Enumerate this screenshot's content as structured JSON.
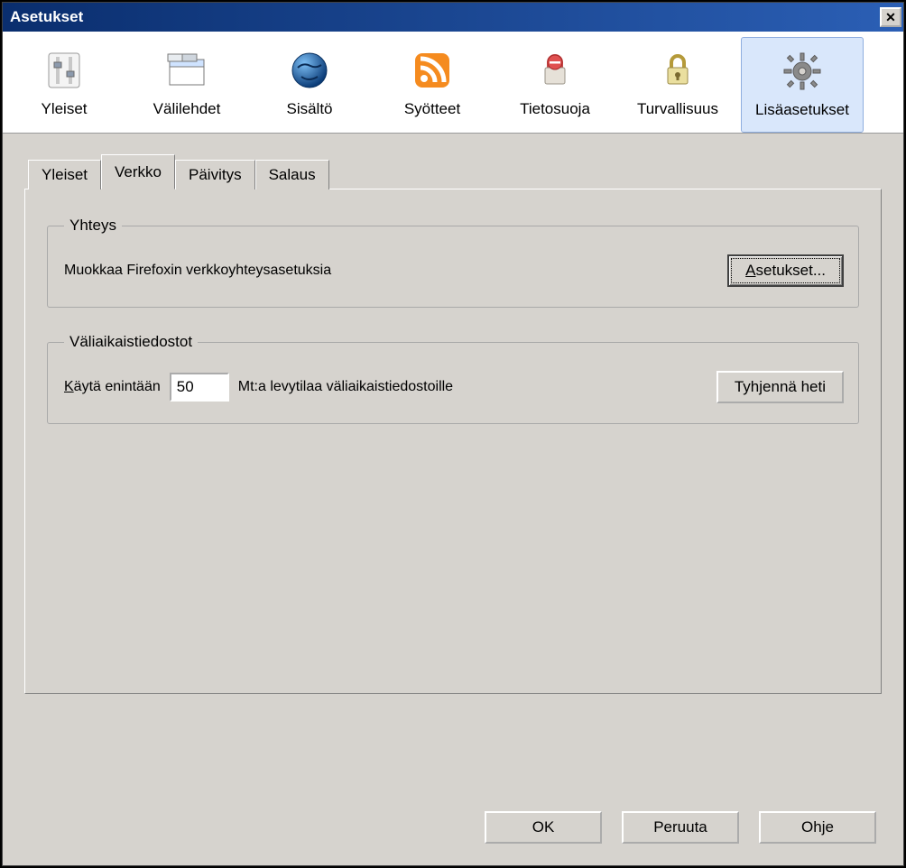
{
  "window": {
    "title": "Asetukset"
  },
  "toolbar": {
    "items": [
      {
        "label": "Yleiset",
        "icon": "sliders-icon"
      },
      {
        "label": "Välilehdet",
        "icon": "tabs-icon"
      },
      {
        "label": "Sisältö",
        "icon": "globe-icon"
      },
      {
        "label": "Syötteet",
        "icon": "rss-icon"
      },
      {
        "label": "Tietosuoja",
        "icon": "privacy-lock-icon"
      },
      {
        "label": "Turvallisuus",
        "icon": "security-lock-icon"
      },
      {
        "label": "Lisäasetukset",
        "icon": "gear-icon"
      }
    ],
    "active": "Lisäasetukset"
  },
  "inner_tabs": {
    "items": [
      "Yleiset",
      "Verkko",
      "Päivitys",
      "Salaus"
    ],
    "active": "Verkko"
  },
  "connection_group": {
    "legend": "Yhteys",
    "description": "Muokkaa Firefoxin verkkoyhteysasetuksia",
    "button": "Asetukset..."
  },
  "cache_group": {
    "legend": "Väliaikaistiedostot",
    "use_up_to_label": "Käytä enintään",
    "value": "50",
    "suffix": "Mt:a levytilaa väliaikaistiedostoille",
    "clear_button": "Tyhjennä heti"
  },
  "dialog_buttons": {
    "ok": "OK",
    "cancel": "Peruuta",
    "help": "Ohje"
  }
}
